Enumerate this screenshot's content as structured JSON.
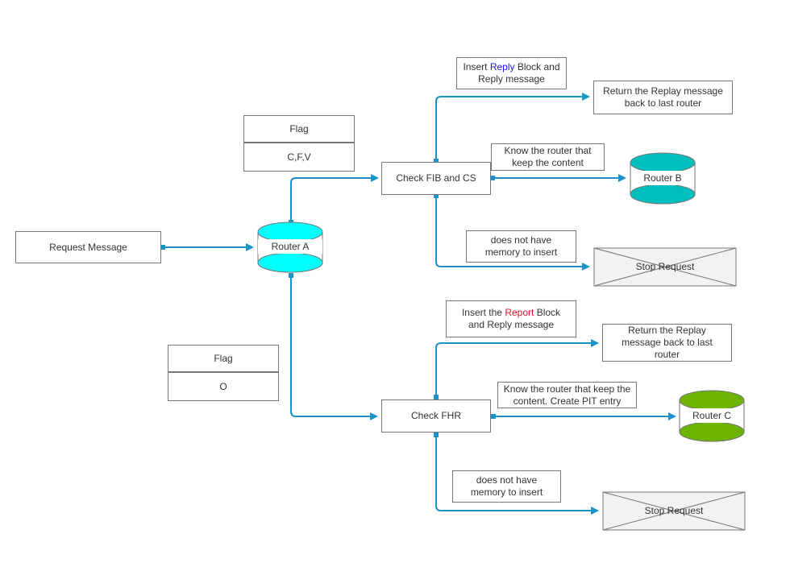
{
  "colors": {
    "connector": "#1A93C8",
    "router_a": "#00FFFF",
    "router_b": "#00BFBF",
    "router_c": "#6EB300",
    "stop_fill": "#F2F2F2",
    "border": "#767676",
    "reply_highlight": "#1A1AFF",
    "report_highlight": "#E0142B"
  },
  "nodes": {
    "request_message": "Request Message",
    "router_a": "Router A",
    "router_b": "Router B",
    "router_c": "Router C",
    "check_fib_cs": "Check FIB and CS",
    "check_fhr": "Check FHR",
    "return_replay_top": "Return the Replay message back to last router",
    "return_replay_bottom": "Return the Replay message back to last router",
    "stop_request_top": "Stop Request",
    "stop_request_bottom": "Stop Request"
  },
  "flags": {
    "top": {
      "header": "Flag",
      "value": "C,F,V"
    },
    "bottom": {
      "header": "Flag",
      "value": "O"
    }
  },
  "notes": {
    "insert_reply": {
      "pre": "Insert ",
      "highlight": "Reply",
      "post": " Block and Reply message"
    },
    "know_router_top": "Know the router that keep the content",
    "no_memory_top": "does not have memory to insert",
    "insert_report": {
      "pre": "Insert the ",
      "highlight": "Report",
      "post": " Block and Reply message"
    },
    "know_router_bottom": "Know the router that keep the content. Create PIT entry",
    "no_memory_bottom": "does not have memory to insert"
  }
}
